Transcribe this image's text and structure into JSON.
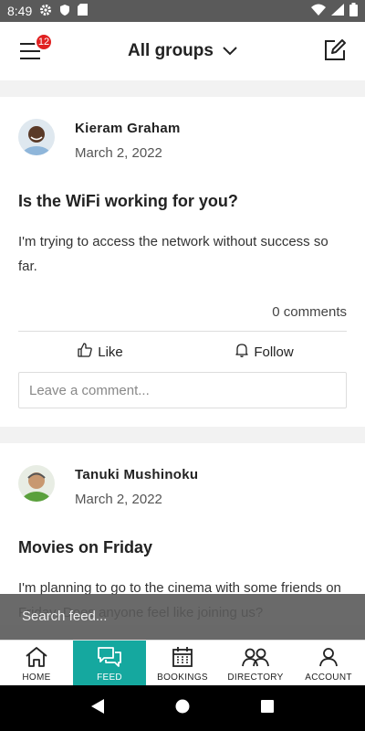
{
  "status_bar": {
    "time": "8:49"
  },
  "header": {
    "menu_badge": "12",
    "group_label": "All groups"
  },
  "posts": [
    {
      "author": "Kieram Graham",
      "date": "March 2, 2022",
      "title": "Is the WiFi working for you?",
      "body": "I'm trying to access the network without success so far.",
      "comments": "0 comments",
      "like_label": "Like",
      "follow_label": "Follow",
      "comment_placeholder": "Leave a comment..."
    },
    {
      "author": "Tanuki Mushinoku",
      "date": "March 2, 2022",
      "title": "Movies on Friday",
      "body": "I'm planning to go to the cinema with some friends on Friday. Does anyone feel like joining us?"
    }
  ],
  "search": {
    "placeholder": "Search feed..."
  },
  "bottom_nav": [
    {
      "label": "HOME",
      "icon": "home-icon"
    },
    {
      "label": "FEED",
      "icon": "chat-icon",
      "active": true
    },
    {
      "label": "BOOKINGS",
      "icon": "calendar-icon"
    },
    {
      "label": "DIRECTORY",
      "icon": "people-icon"
    },
    {
      "label": "ACCOUNT",
      "icon": "person-icon"
    }
  ],
  "colors": {
    "accent": "#15a89f",
    "badge": "#e02020"
  }
}
